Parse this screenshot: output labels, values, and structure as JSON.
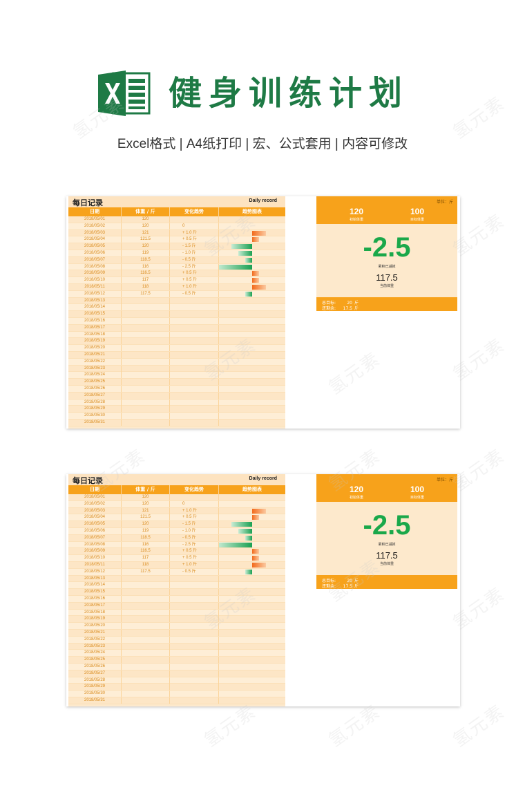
{
  "header": {
    "title": "健身训练计划",
    "subtitle": "Excel格式 |  A4纸打印 | 宏、公式套用 | 内容可修改"
  },
  "sheet": {
    "title": "每日记录",
    "title_en": "Daily record",
    "columns": [
      "日期",
      "体重 / 斤",
      "变化趋势",
      "趋势图表"
    ],
    "rows": [
      {
        "date": "2018/05/01",
        "weight": "120",
        "change": "",
        "delta": 0
      },
      {
        "date": "2018/05/02",
        "weight": "120",
        "change": "0",
        "delta": 0
      },
      {
        "date": "2018/05/03",
        "weight": "121",
        "change": "+ 1.0 斤",
        "delta": 1.0
      },
      {
        "date": "2018/05/04",
        "weight": "121.5",
        "change": "+ 0.5 斤",
        "delta": 0.5
      },
      {
        "date": "2018/05/05",
        "weight": "120",
        "change": "-  1.5 斤",
        "delta": -1.5
      },
      {
        "date": "2018/05/06",
        "weight": "119",
        "change": "-  1.0 斤",
        "delta": -1.0
      },
      {
        "date": "2018/05/07",
        "weight": "118.5",
        "change": "-  0.5 斤",
        "delta": -0.5
      },
      {
        "date": "2018/05/08",
        "weight": "116",
        "change": "-  2.5 斤",
        "delta": -2.5
      },
      {
        "date": "2018/05/09",
        "weight": "116.5",
        "change": "+ 0.5 斤",
        "delta": 0.5
      },
      {
        "date": "2018/05/10",
        "weight": "117",
        "change": "+ 0.5 斤",
        "delta": 0.5
      },
      {
        "date": "2018/05/11",
        "weight": "118",
        "change": "+ 1.0 斤",
        "delta": 1.0
      },
      {
        "date": "2018/05/12",
        "weight": "117.5",
        "change": "-  0.5 斤",
        "delta": -0.5
      },
      {
        "date": "2018/05/13",
        "weight": "",
        "change": "",
        "delta": 0
      },
      {
        "date": "2018/05/14",
        "weight": "",
        "change": "",
        "delta": 0
      },
      {
        "date": "2018/05/15",
        "weight": "",
        "change": "",
        "delta": 0
      },
      {
        "date": "2018/05/16",
        "weight": "",
        "change": "",
        "delta": 0
      },
      {
        "date": "2018/05/17",
        "weight": "",
        "change": "",
        "delta": 0
      },
      {
        "date": "2018/05/18",
        "weight": "",
        "change": "",
        "delta": 0
      },
      {
        "date": "2018/05/19",
        "weight": "",
        "change": "",
        "delta": 0
      },
      {
        "date": "2018/05/20",
        "weight": "",
        "change": "",
        "delta": 0
      },
      {
        "date": "2018/05/21",
        "weight": "",
        "change": "",
        "delta": 0
      },
      {
        "date": "2018/05/22",
        "weight": "",
        "change": "",
        "delta": 0
      },
      {
        "date": "2018/05/23",
        "weight": "",
        "change": "",
        "delta": 0
      },
      {
        "date": "2018/05/24",
        "weight": "",
        "change": "",
        "delta": 0
      },
      {
        "date": "2018/05/25",
        "weight": "",
        "change": "",
        "delta": 0
      },
      {
        "date": "2018/05/26",
        "weight": "",
        "change": "",
        "delta": 0
      },
      {
        "date": "2018/05/27",
        "weight": "",
        "change": "",
        "delta": 0
      },
      {
        "date": "2018/05/28",
        "weight": "",
        "change": "",
        "delta": 0
      },
      {
        "date": "2018/05/29",
        "weight": "",
        "change": "",
        "delta": 0
      },
      {
        "date": "2018/05/30",
        "weight": "",
        "change": "",
        "delta": 0
      },
      {
        "date": "2018/05/31",
        "weight": "",
        "change": "",
        "delta": 0
      }
    ]
  },
  "dashboard": {
    "unit": "单位：斤",
    "start_value": "120",
    "start_label": "初始体重",
    "target_value": "100",
    "target_label": "目标体重",
    "loss_value": "-2.5",
    "loss_label": "累积已减掉",
    "current_value": "117.5",
    "current_label": "当前体重",
    "goal_label": "总目标:",
    "goal_value": "20",
    "goal_unit": "斤",
    "remain_label": "还剩余:",
    "remain_value": "17.5",
    "remain_unit": "斤"
  },
  "watermark": "氢元素",
  "colors": {
    "brand_green": "#1e7a45",
    "accent_orange": "#f7a21b",
    "sheet_bg": "#fde9cc",
    "loss_green": "#1aa84a",
    "bar_up": "#f26b1d",
    "bar_down": "#1aa052"
  }
}
